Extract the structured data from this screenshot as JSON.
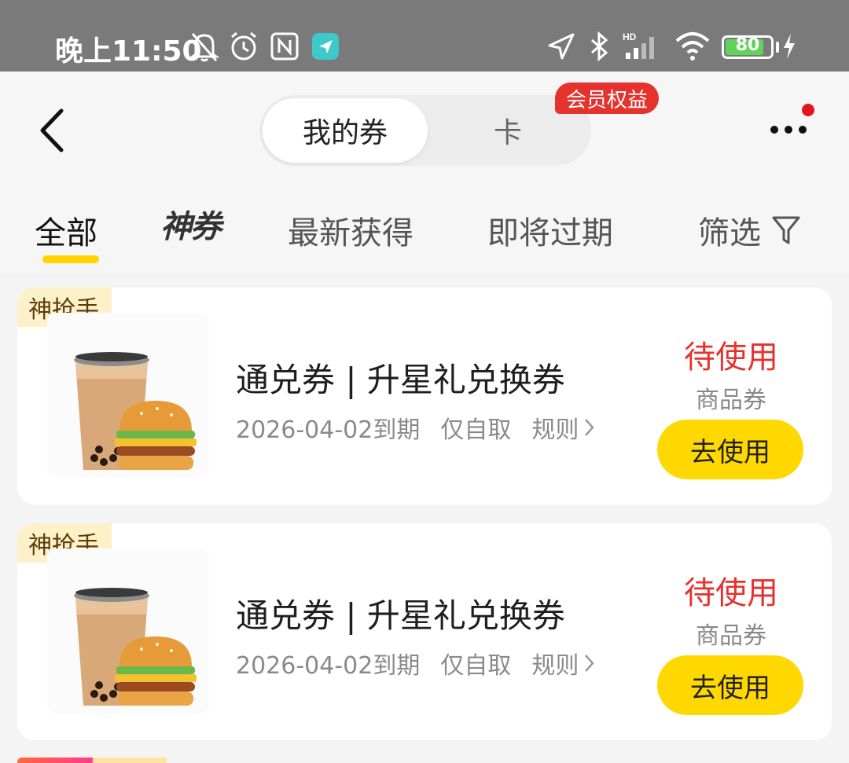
{
  "status_bar": {
    "time": "晚上11:50",
    "battery": "80",
    "icons": [
      "bell-off-icon",
      "alarm-icon",
      "nfc-icon",
      "app-notification-icon",
      "location-icon",
      "bluetooth-icon",
      "signal-hd-icon",
      "wifi-icon",
      "battery-icon",
      "charging-icon"
    ]
  },
  "header": {
    "tab_coupons": "我的券",
    "tab_cards": "卡",
    "member_badge": "会员权益"
  },
  "filters": {
    "all": "全部",
    "shen": "神券",
    "newest": "最新获得",
    "expiring": "即将过期",
    "filter": "筛选"
  },
  "coupons": [
    {
      "tag": "神抢手",
      "title": "通兑券 | 升星礼兑换券",
      "expiry": "2026-04-02到期",
      "pickup": "仅自取",
      "rules": "规则",
      "status": "待使用",
      "type": "商品券",
      "action": "去使用"
    },
    {
      "tag": "神抢手",
      "title": "通兑券 | 升星礼兑换券",
      "expiry": "2026-04-02到期",
      "pickup": "仅自取",
      "rules": "规则",
      "status": "待使用",
      "type": "商品券",
      "action": "去使用"
    }
  ],
  "colors": {
    "accent_yellow": "#ffd800",
    "status_red": "#e5322d",
    "tag_bg": "#fdf1c9"
  }
}
